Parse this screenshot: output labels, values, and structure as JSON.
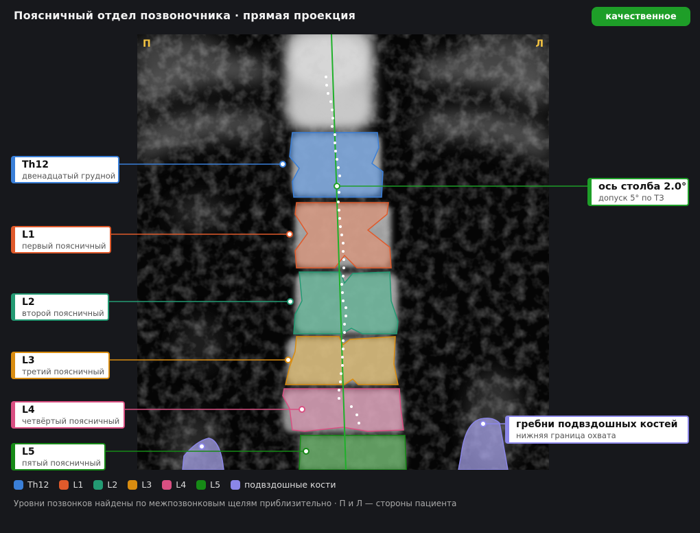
{
  "header": {
    "title": "Поясничный отдел позвоночника · прямая проекция",
    "quality_badge": "качественное"
  },
  "viewer": {
    "side_right_patient": "П",
    "side_left_patient": "Л"
  },
  "levels": [
    {
      "id": "th12",
      "label": "Th12",
      "subtitle": "двенадцатый грудной",
      "color": "#3a7fd8"
    },
    {
      "id": "l1",
      "label": "L1",
      "subtitle": "первый поясничный",
      "color": "#e05a2b"
    },
    {
      "id": "l2",
      "label": "L2",
      "subtitle": "второй поясничный",
      "color": "#239a73"
    },
    {
      "id": "l3",
      "label": "L3",
      "subtitle": "третий поясничный",
      "color": "#d98c10"
    },
    {
      "id": "l4",
      "label": "L4",
      "subtitle": "четвёртый поясничный",
      "color": "#d94f82"
    },
    {
      "id": "l5",
      "label": "L5",
      "subtitle": "пятый поясничный",
      "color": "#168a16"
    }
  ],
  "axis": {
    "label": "ось столба 2.0°",
    "subtitle": "допуск 5° по ТЗ",
    "color": "#1e9e28"
  },
  "iliac": {
    "label": "гребни подвздошных костей",
    "subtitle": "нижняя граница охвата",
    "color": "#8b86e8"
  },
  "legend": [
    {
      "name": "Th12",
      "color": "#3a7fd8"
    },
    {
      "name": "L1",
      "color": "#e05a2b"
    },
    {
      "name": "L2",
      "color": "#239a73"
    },
    {
      "name": "L3",
      "color": "#d98c10"
    },
    {
      "name": "L4",
      "color": "#d94f82"
    },
    {
      "name": "L5",
      "color": "#168a16"
    },
    {
      "name": "подвздошные кости",
      "color": "#8b86e8"
    }
  ],
  "footnote": "Уровни позвонков найдены по межпозвонковым щелям приблизительно · П и Л — стороны пациента"
}
